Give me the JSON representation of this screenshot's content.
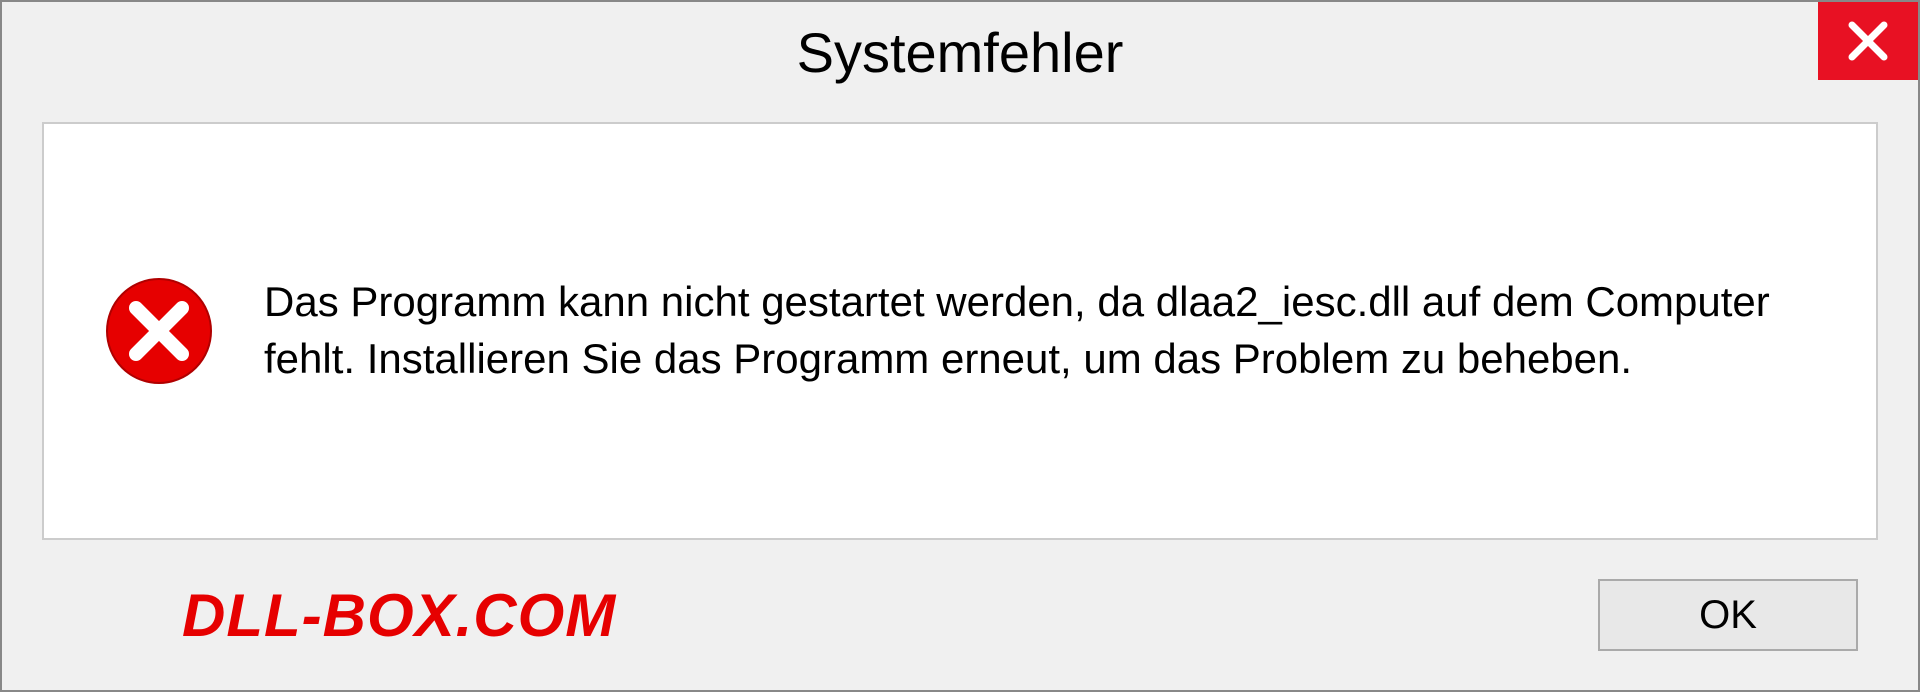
{
  "dialog": {
    "title": "Systemfehler",
    "message": "Das Programm kann nicht gestartet werden, da dlaa2_iesc.dll auf dem Computer fehlt. Installieren Sie das Programm erneut, um das Problem zu beheben.",
    "ok_label": "OK"
  },
  "watermark": "DLL-BOX.COM"
}
